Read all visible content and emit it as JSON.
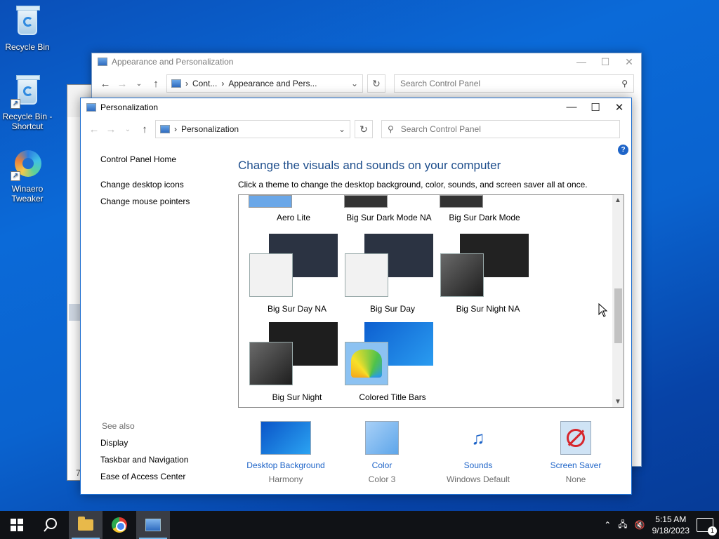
{
  "desktop": {
    "icons": [
      {
        "label": "Recycle Bin"
      },
      {
        "label": "Recycle Bin - Shortcut"
      },
      {
        "label": "Winaero Tweaker"
      }
    ]
  },
  "back_window": {
    "title": "Appearance and Personalization",
    "address": {
      "crumb1": "Cont...",
      "crumb2": "Appearance and Pers..."
    },
    "search_placeholder": "Search Control Panel"
  },
  "peek_window": {
    "text": "7"
  },
  "front_window": {
    "title": "Personalization",
    "address": {
      "crumb": "Personalization"
    },
    "search_placeholder": "Search Control Panel",
    "sidebar": {
      "home": "Control Panel Home",
      "links": [
        "Change desktop icons",
        "Change mouse pointers"
      ],
      "see_also_header": "See also",
      "see_also": [
        "Display",
        "Taskbar and Navigation",
        "Ease of Access Center"
      ]
    },
    "heading": "Change the visuals and sounds on your computer",
    "subheading": "Click a theme to change the desktop background, color, sounds, and screen saver all at once.",
    "themes_top_row": [
      "Aero Lite",
      "Big Sur Dark Mode NA",
      "Big Sur Dark Mode"
    ],
    "themes": [
      {
        "name": "Big Sur Day NA",
        "bg": "#2b3342",
        "win": "#f2f2f2"
      },
      {
        "name": "Big Sur Day",
        "bg": "#2b3342",
        "win": "#f2f2f2"
      },
      {
        "name": "Big Sur Night NA",
        "bg": "#222222",
        "win": "#3a3a3a"
      },
      {
        "name": "Big Sur Night",
        "bg": "#1e1e1e",
        "win": "#3a3a3a"
      },
      {
        "name": "Colored Title Bars",
        "bg": "#1a7be0",
        "win": "#7db8ee"
      }
    ],
    "bottom": [
      {
        "label": "Desktop Background",
        "value": "Harmony"
      },
      {
        "label": "Color",
        "value": "Color 3"
      },
      {
        "label": "Sounds",
        "value": "Windows Default"
      },
      {
        "label": "Screen Saver",
        "value": "None"
      }
    ]
  },
  "taskbar": {
    "time": "5:15 AM",
    "date": "9/18/2023",
    "notification_count": "1"
  },
  "colors": {
    "accent": "#1e64c8",
    "heading": "#1e4e8c",
    "taskbar": "#101216"
  }
}
